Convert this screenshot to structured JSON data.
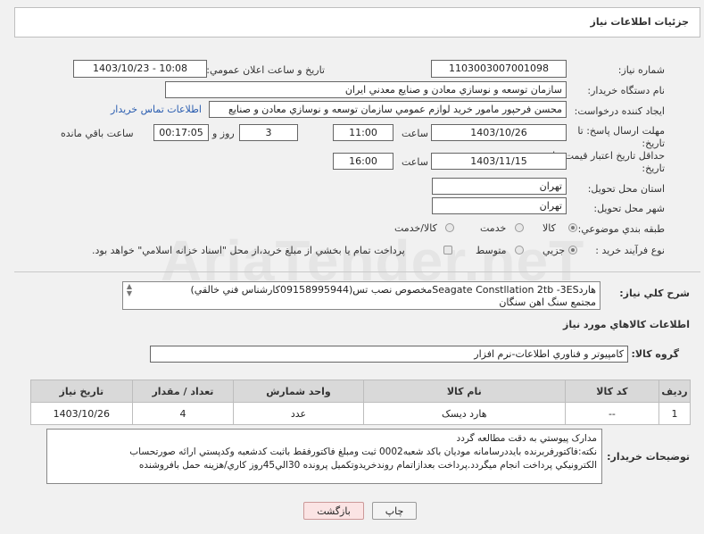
{
  "page_title": "جزئيات اطلاعات نياز",
  "fields": {
    "need_number_label": "شماره نياز:",
    "need_number": "1103003007001098",
    "announce_label": "تاريخ و ساعت اعلان عمومي:",
    "announce_value": "1403/10/23 - 10:08",
    "buyer_org_label": "نام دستگاه خريدار:",
    "buyer_org": "سازمان توسعه و نوسازي معادن و صنايع معدني ايران",
    "creator_label": "ايجاد کننده درخواست:",
    "creator": "محسن فرحپور مامور خريد لوازم عمومي سازمان توسعه و نوسازي معادن و صنايع",
    "contact_link": "اطلاعات تماس خريدار",
    "deadline_label_1": "مهلت ارسال پاسخ: تا",
    "deadline_label_2": "تاريخ:",
    "deadline_date": "1403/10/26",
    "time_label": "ساعت",
    "deadline_time": "11:00",
    "days_value": "3",
    "days_label": "روز و",
    "remaining_time": "00:17:05",
    "remaining_label": "ساعت باقي مانده",
    "validity_label_1": "حداقل تاريخ اعتبار قيمت: تا",
    "validity_label_2": "تاريخ:",
    "validity_date": "1403/11/15",
    "validity_time": "16:00",
    "province_label": "استان محل تحويل:",
    "province": "تهران",
    "city_label": "شهر محل تحويل:",
    "city": "تهران",
    "category_label": "طبقه بندي موضوعي:",
    "category_options": [
      "کالا",
      "خدمت",
      "کالا/خدمت"
    ],
    "process_label": "نوع فرآيند خريد :",
    "process_options": [
      "جزيي",
      "متوسط"
    ],
    "process_note": "پرداخت تمام يا بخشي از مبلغ خريد،از محل \"اسناد خزانه اسلامي\" خواهد بود."
  },
  "description": {
    "label": "شرح کلي نياز:",
    "line1": "هاردSeagate Constllation 2tb -3ESمخصوص نصب تس(09158995944کارشناس فني خالقي)",
    "line2": "مجتمع سنگ اهن سنگان"
  },
  "goods_section_title": "اطلاعات کالاهاي مورد نياز",
  "goods_group_label": "گروه کالا:",
  "goods_group": "کامپيوتر و فناوري اطلاعات-نرم افزار",
  "table": {
    "headers": [
      "رديف",
      "کد کالا",
      "نام کالا",
      "واحد شمارش",
      "تعداد / مقدار",
      "تاريخ نياز"
    ],
    "rows": [
      [
        "1",
        "--",
        "هارد ديسک",
        "عدد",
        "4",
        "1403/10/26"
      ]
    ]
  },
  "buyer_notes": {
    "label": "توضيحات خريدار:",
    "line1": "مدارک پيوستي به دقت مطالعه گردد",
    "line2": "نکته:فاکتورفربرنده بايددرسامانه موديان باکد شعبه0002 ثبت ومبلغ فاکتورفقط باثبت کدشعبه وکدپستي ارائه صورتحساب",
    "line3": "الکترونيکي پرداخت انجام ميگردد.پرداخت بعدازاتمام روندخريدوتکميل پرونده 30الي45روز کاري/هزينه حمل بافروشنده"
  },
  "buttons": {
    "print": "چاپ",
    "back": "بازگشت"
  },
  "watermark": "AriaTender.neT"
}
